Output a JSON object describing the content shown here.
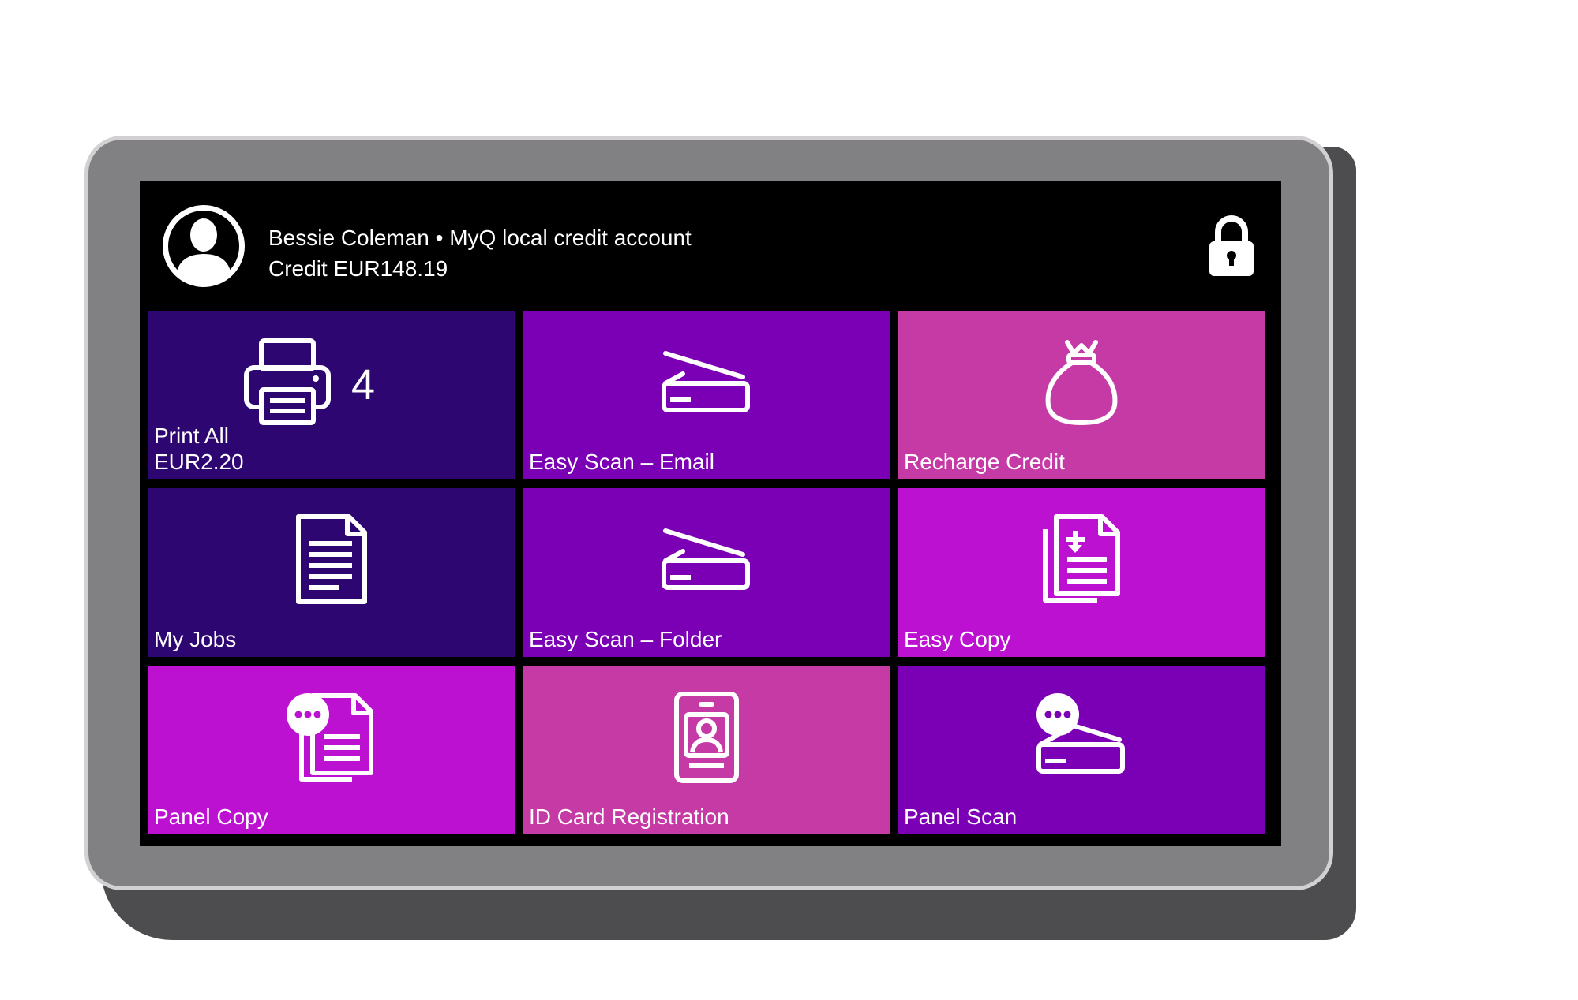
{
  "header": {
    "user_line": "Bessie Coleman • MyQ local credit account",
    "credit_line": "Credit EUR148.19",
    "avatar_icon": "user-avatar-icon",
    "lock_icon": "lock-icon"
  },
  "tiles": [
    {
      "id": "print-all",
      "label_line1": "Print All",
      "label_line2": "EUR2.20",
      "count": "4",
      "icon": "printer-icon",
      "color": "#2e0671"
    },
    {
      "id": "easy-scan-email",
      "label": "Easy Scan – Email",
      "icon": "scanner-icon",
      "color": "#7b00b5"
    },
    {
      "id": "recharge-credit",
      "label": "Recharge Credit",
      "icon": "money-bag-icon",
      "color": "#c53aa5"
    },
    {
      "id": "my-jobs",
      "label": "My Jobs",
      "icon": "document-icon",
      "color": "#2e0671"
    },
    {
      "id": "easy-scan-folder",
      "label": "Easy Scan – Folder",
      "icon": "scanner-icon",
      "color": "#7b00b5"
    },
    {
      "id": "easy-copy",
      "label": "Easy Copy",
      "icon": "copy-documents-icon",
      "color": "#bc11d1"
    },
    {
      "id": "panel-copy",
      "label": "Panel Copy",
      "icon": "panel-copy-icon",
      "color": "#bc11d1"
    },
    {
      "id": "id-card-registration",
      "label": "ID Card Registration",
      "icon": "id-card-icon",
      "color": "#c53aa5"
    },
    {
      "id": "panel-scan",
      "label": "Panel Scan",
      "icon": "panel-scan-icon",
      "color": "#7b00b5"
    }
  ]
}
